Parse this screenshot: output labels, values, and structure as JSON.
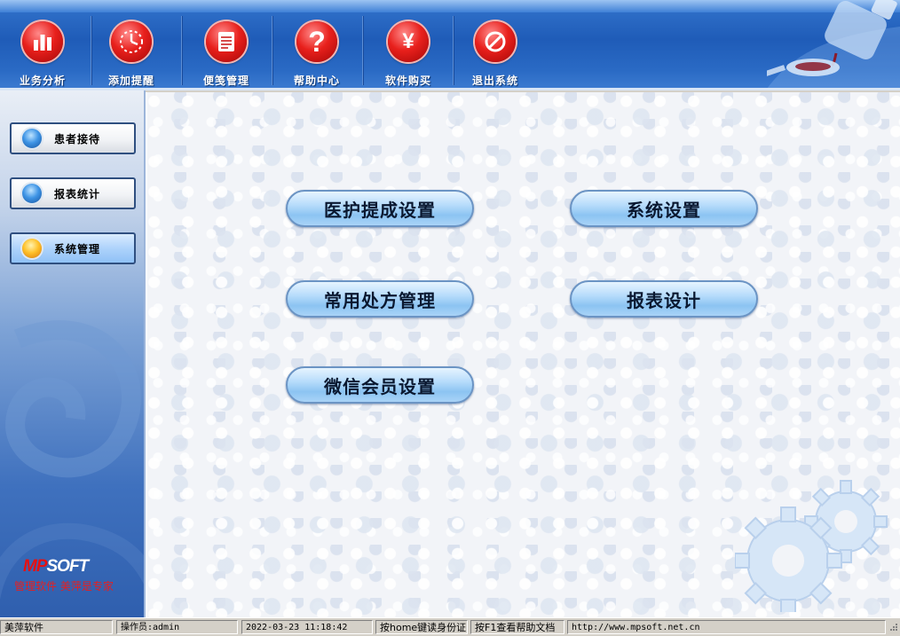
{
  "toolbar": {
    "items": [
      {
        "label": "业务分析",
        "icon": "bar-chart-icon"
      },
      {
        "label": "添加提醒",
        "icon": "clock-icon"
      },
      {
        "label": "便笺管理",
        "icon": "notepad-icon"
      },
      {
        "label": "帮助中心",
        "icon": "help-icon"
      },
      {
        "label": "软件购买",
        "icon": "yen-icon"
      },
      {
        "label": "退出系统",
        "icon": "no-entry-icon"
      }
    ]
  },
  "sidebar": {
    "items": [
      {
        "label": "患者接待",
        "active": false
      },
      {
        "label": "报表统计",
        "active": false
      },
      {
        "label": "系统管理",
        "active": true
      }
    ],
    "logo": {
      "brand_mp": "MP",
      "brand_soft": "SOFT",
      "slogan": "管理软件 美萍是专家"
    }
  },
  "main": {
    "buttons": [
      {
        "label": "医护提成设置"
      },
      {
        "label": "系统设置"
      },
      {
        "label": "常用处方管理"
      },
      {
        "label": "报表设计"
      },
      {
        "label": "微信会员设置"
      }
    ]
  },
  "status": {
    "company": "美萍软件",
    "operator": "操作员:admin",
    "datetime": "2022-03-23 11:18:42",
    "hint_home": "按home键读身份证",
    "hint_f1": "按F1查看帮助文档",
    "url": "http://www.mpsoft.net.cn"
  },
  "colors": {
    "toolbar_blue": "#1f5cb8",
    "icon_red": "#e8201c",
    "action_button": "#8cc4f2",
    "active_nav": "#aed3fb"
  }
}
